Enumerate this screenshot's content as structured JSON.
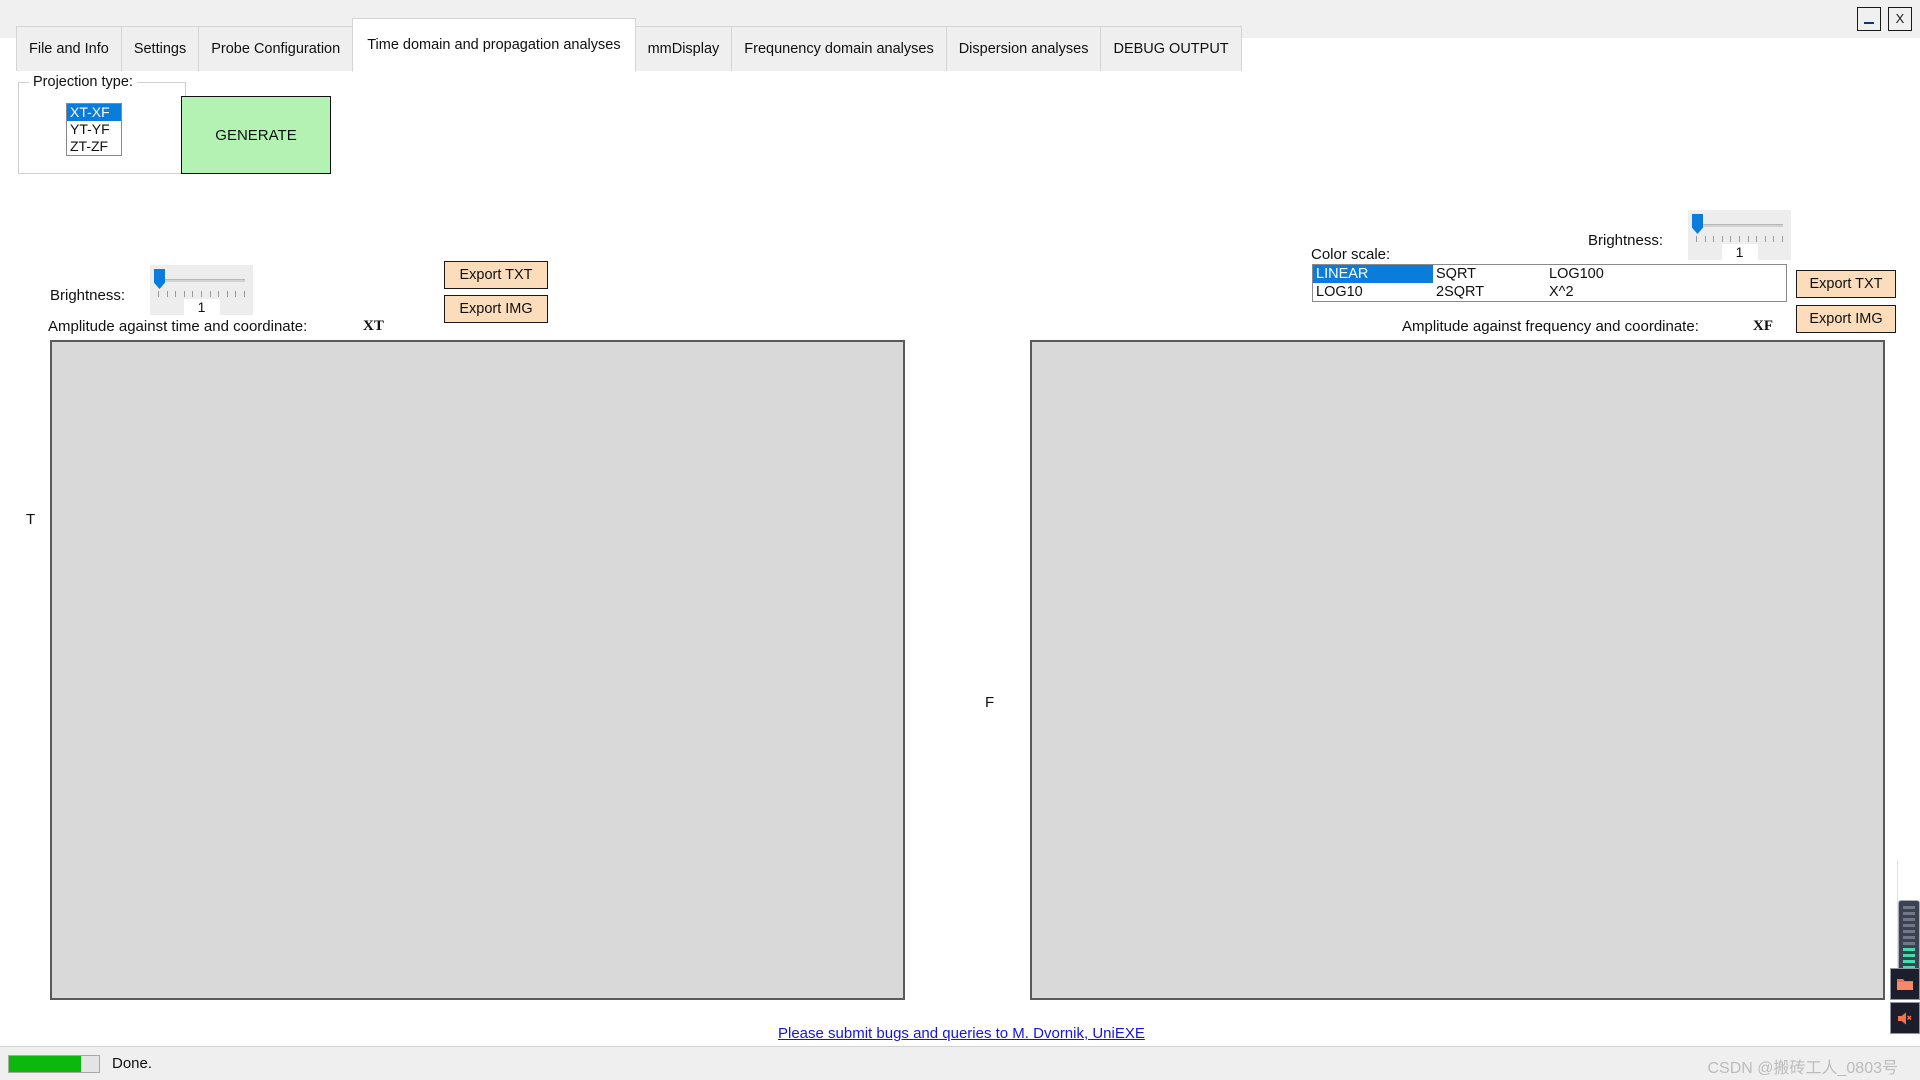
{
  "window": {
    "controls": [
      {
        "name": "minimize",
        "label": "_"
      },
      {
        "name": "close",
        "label": "X"
      }
    ]
  },
  "tabs": [
    {
      "label": "File and Info",
      "active": false
    },
    {
      "label": "Settings",
      "active": false
    },
    {
      "label": "Probe Configuration",
      "active": false
    },
    {
      "label": "Time domain and propagation analyses",
      "active": true
    },
    {
      "label": "mmDisplay",
      "active": false
    },
    {
      "label": "Frequnency domain analyses",
      "active": false
    },
    {
      "label": "Dispersion analyses",
      "active": false
    },
    {
      "label": "DEBUG OUTPUT",
      "active": false
    }
  ],
  "projection": {
    "group_title": "Projection type:",
    "options": [
      {
        "label": "XT-XF",
        "selected": true
      },
      {
        "label": "YT-YF",
        "selected": false
      },
      {
        "label": "ZT-ZF",
        "selected": false
      }
    ]
  },
  "generate_button": {
    "label": "GENERATE",
    "color": "#b3f2b3"
  },
  "left_panel": {
    "brightness_label": "Brightness:",
    "brightness_value": "1",
    "export_txt": "Export TXT",
    "export_img": "Export IMG",
    "caption": "Amplitude against time and coordinate:",
    "tag": "XT",
    "axis_label": "T"
  },
  "right_panel": {
    "brightness_label": "Brightness:",
    "brightness_value": "1",
    "color_scale_label": "Color scale:",
    "color_scale_options": [
      [
        "LINEAR",
        "SQRT",
        "LOG100"
      ],
      [
        "LOG10",
        "2SQRT",
        "X^2"
      ]
    ],
    "color_scale_selected": "LINEAR",
    "export_txt": "Export TXT",
    "export_img": "Export IMG",
    "caption": "Amplitude against frequency and coordinate:",
    "tag": "XF",
    "axis_label": "F"
  },
  "footer": {
    "link_text": "Please submit bugs and queries to M. Dvornik, UniEXE"
  },
  "status": {
    "text": "Done.",
    "progress_percent": 80,
    "progress_color": "#0db80d"
  },
  "watermark": {
    "text": "CSDN @搬砖工人_0803号"
  },
  "edge_widgets": {
    "meter_name": "level-meter-icon",
    "folder_name": "folder-icon",
    "speaker_name": "speaker-icon"
  }
}
